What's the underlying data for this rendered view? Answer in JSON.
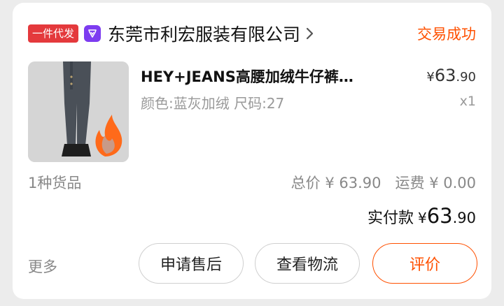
{
  "header": {
    "badge": "一件代发",
    "shop_name": "东莞市利宏服装有限公司",
    "status": "交易成功",
    "status_color": "#ff5000",
    "shop_icon": "shop-logo-icon",
    "chevron_icon": "chevron-right-icon"
  },
  "product": {
    "title": "HEY+JEANS高腰加绒牛仔裤…",
    "sku": "颜色:蓝灰加绒  尺码:27",
    "price_currency": "¥",
    "price_int": "63",
    "price_dec": ".90",
    "quantity": "x1"
  },
  "summary": {
    "kinds": "1种货品",
    "total": "总价 ¥ 63.90",
    "shipping": "运费 ¥ 0.00",
    "paid_label": "实付款",
    "paid_currency": "¥",
    "paid_int": "63",
    "paid_dec": ".90"
  },
  "footer": {
    "more": "更多",
    "after_sale": "申请售后",
    "logistics": "查看物流",
    "review": "评价"
  },
  "colors": {
    "accent": "#ff5000",
    "badge_bg": "#e4393c",
    "shop_icon_bg": "#7d3cf0"
  }
}
